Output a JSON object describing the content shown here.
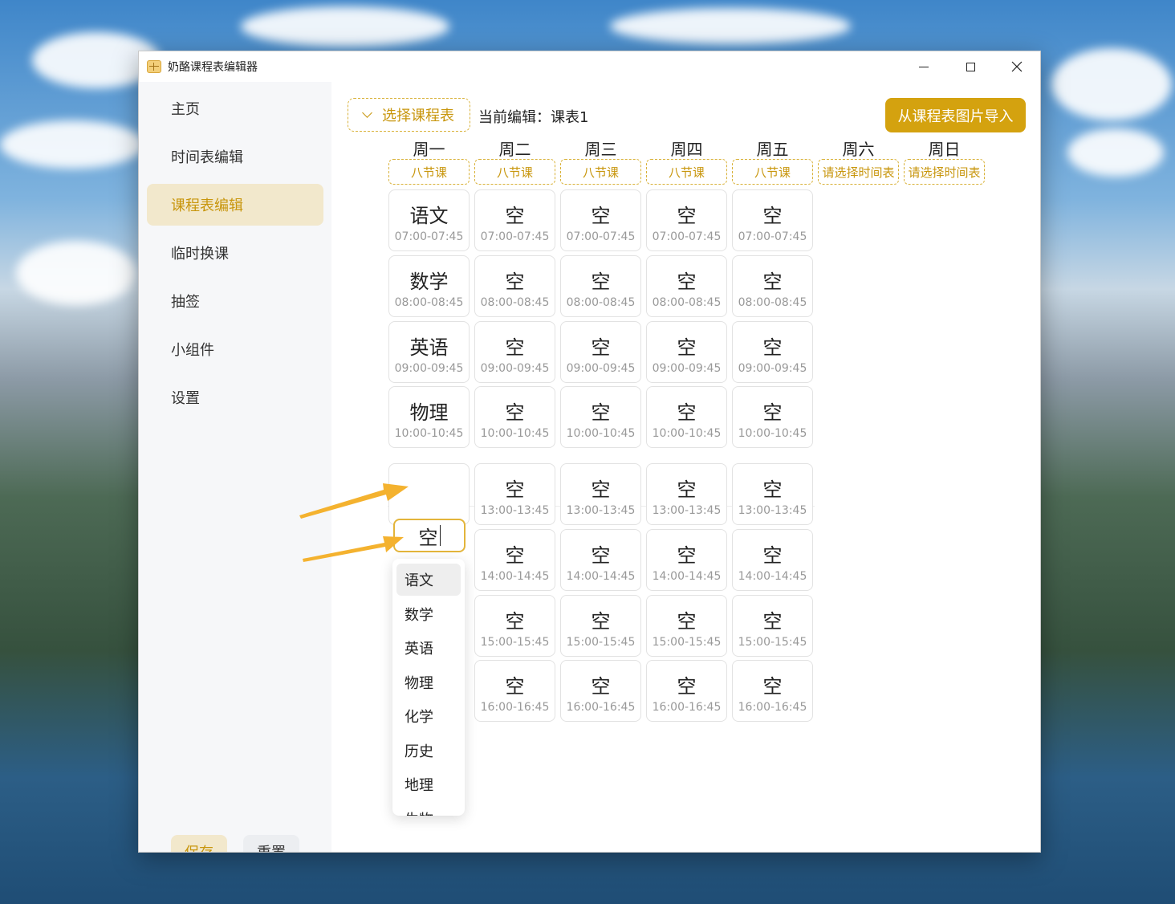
{
  "window": {
    "title": "奶酪课程表编辑器"
  },
  "sidebar": {
    "items": [
      {
        "label": "主页",
        "active": false
      },
      {
        "label": "时间表编辑",
        "active": false
      },
      {
        "label": "课程表编辑",
        "active": true
      },
      {
        "label": "临时换课",
        "active": false
      },
      {
        "label": "抽签",
        "active": false
      },
      {
        "label": "小组件",
        "active": false
      },
      {
        "label": "设置",
        "active": false
      }
    ],
    "save_label": "保存",
    "reset_label": "重置"
  },
  "toolbar": {
    "select_label": "选择课程表",
    "current_label": "当前编辑：课表1",
    "import_label": "从课程表图片导入"
  },
  "days": [
    {
      "name": "周一",
      "tag": "八节课"
    },
    {
      "name": "周二",
      "tag": "八节课"
    },
    {
      "name": "周三",
      "tag": "八节课"
    },
    {
      "name": "周四",
      "tag": "八节课"
    },
    {
      "name": "周五",
      "tag": "八节课"
    },
    {
      "name": "周六",
      "tag": "请选择时间表"
    },
    {
      "name": "周日",
      "tag": "请选择时间表"
    }
  ],
  "times": [
    "07:00-07:45",
    "08:00-08:45",
    "09:00-09:45",
    "10:00-10:45",
    "13:00-13:45",
    "14:00-14:45",
    "15:00-15:45",
    "16:00-16:45"
  ],
  "schedule": [
    [
      "语文",
      "空",
      "空",
      "空",
      "空"
    ],
    [
      "数学",
      "空",
      "空",
      "空",
      "空"
    ],
    [
      "英语",
      "空",
      "空",
      "空",
      "空"
    ],
    [
      "物理",
      "空",
      "空",
      "空",
      "空"
    ],
    [
      "空",
      "空",
      "空",
      "空",
      "空"
    ],
    [
      "",
      "空",
      "空",
      "空",
      "空"
    ],
    [
      "",
      "空",
      "空",
      "空",
      "空"
    ],
    [
      "",
      "空",
      "空",
      "空",
      "空"
    ]
  ],
  "editing": {
    "value": "空"
  },
  "dropdown": {
    "options": [
      "语文",
      "数学",
      "英语",
      "物理",
      "化学",
      "历史",
      "地理",
      "生物"
    ],
    "hover_index": 0
  },
  "colors": {
    "accent": "#d4a20f",
    "accent_light": "#f2e8cc",
    "accent_text": "#c8960d"
  }
}
